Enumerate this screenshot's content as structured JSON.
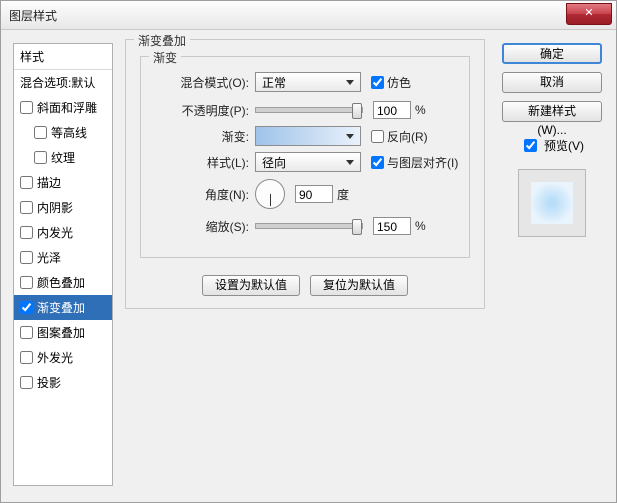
{
  "window": {
    "title": "图层样式",
    "close_glyph": "✕"
  },
  "styles_panel": {
    "header": "样式",
    "blend_options": "混合选项:默认",
    "items": [
      {
        "label": "斜面和浮雕",
        "checked": false,
        "selected": false,
        "indent": false
      },
      {
        "label": "等高线",
        "checked": false,
        "selected": false,
        "indent": true
      },
      {
        "label": "纹理",
        "checked": false,
        "selected": false,
        "indent": true
      },
      {
        "label": "描边",
        "checked": false,
        "selected": false,
        "indent": false
      },
      {
        "label": "内阴影",
        "checked": false,
        "selected": false,
        "indent": false
      },
      {
        "label": "内发光",
        "checked": false,
        "selected": false,
        "indent": false
      },
      {
        "label": "光泽",
        "checked": false,
        "selected": false,
        "indent": false
      },
      {
        "label": "颜色叠加",
        "checked": false,
        "selected": false,
        "indent": false
      },
      {
        "label": "渐变叠加",
        "checked": true,
        "selected": true,
        "indent": false
      },
      {
        "label": "图案叠加",
        "checked": false,
        "selected": false,
        "indent": false
      },
      {
        "label": "外发光",
        "checked": false,
        "selected": false,
        "indent": false
      },
      {
        "label": "投影",
        "checked": false,
        "selected": false,
        "indent": false
      }
    ]
  },
  "content": {
    "group_title": "渐变叠加",
    "inner_title": "渐变",
    "blend_mode_label": "混合模式(O):",
    "blend_mode_value": "正常",
    "dither_label": "仿色",
    "opacity_label": "不透明度(P):",
    "opacity_value": "100",
    "opacity_unit": "%",
    "gradient_label": "渐变:",
    "reverse_label": "反向(R)",
    "style_label": "样式(L):",
    "style_value": "径向",
    "align_label": "与图层对齐(I)",
    "angle_label": "角度(N):",
    "angle_value": "90",
    "angle_unit": "度",
    "scale_label": "缩放(S):",
    "scale_value": "150",
    "scale_unit": "%",
    "reset_default": "设置为默认值",
    "restore_default": "复位为默认值"
  },
  "right": {
    "ok": "确定",
    "cancel": "取消",
    "new_style": "新建样式(W)...",
    "preview_label": "预览(V)"
  }
}
